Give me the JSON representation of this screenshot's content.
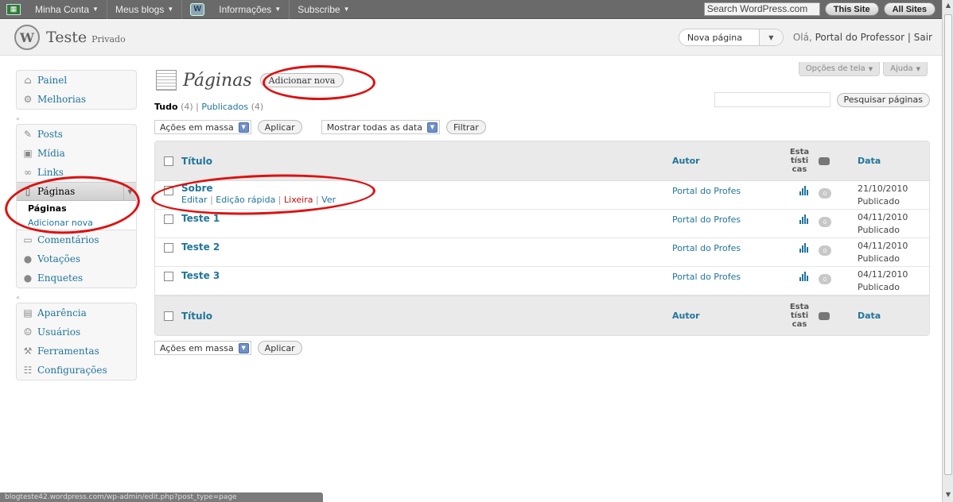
{
  "topbar": {
    "account": "Minha Conta",
    "blogs": "Meus blogs",
    "info": "Informações",
    "subscribe": "Subscribe",
    "search": "Search WordPress.com",
    "this_site": "This Site",
    "all_sites": "All Sites"
  },
  "header": {
    "logo_letter": "W",
    "site_title": "Teste",
    "site_private": "Privado",
    "new_page": "Nova página",
    "greeting": "Olá, ",
    "user": "Portal do Professor",
    "separator": " | ",
    "logout": "Sair"
  },
  "screen_options": {
    "options": "Opções de tela",
    "help": "Ajuda"
  },
  "sidebar": {
    "painel": "Painel",
    "melhorias": "Melhorias",
    "posts": "Posts",
    "midia": "Mídia",
    "links": "Links",
    "paginas": "Páginas",
    "sub_paginas": "Páginas",
    "sub_add": "Adicionar nova",
    "comentarios": "Comentários",
    "votacoes": "Votações",
    "enquetes": "Enquetes",
    "aparencia": "Aparência",
    "usuarios": "Usuários",
    "ferramentas": "Ferramentas",
    "configuracoes": "Configurações"
  },
  "main": {
    "title": "Páginas",
    "add_new": "Adicionar nova",
    "filter_all": "Tudo",
    "filter_all_count": "(4)",
    "filter_sep": "|",
    "filter_published": "Publicados",
    "filter_published_count": "(4)",
    "search_button": "Pesquisar páginas",
    "bulk_actions": "Ações em massa",
    "apply": "Aplicar",
    "dates": "Mostrar todas as data",
    "filter": "Filtrar"
  },
  "table": {
    "col_title": "Título",
    "col_author": "Autor",
    "col_stats": "Esta\ntísti\ncas",
    "col_date": "Data",
    "rows": [
      {
        "title": "Sobre",
        "author": "Portal do Profes",
        "comments": "0",
        "date": "21/10/2010",
        "status": "Publicado"
      },
      {
        "title": "Teste 1",
        "author": "Portal do Profes",
        "comments": "0",
        "date": "04/11/2010",
        "status": "Publicado"
      },
      {
        "title": "Teste 2",
        "author": "Portal do Profes",
        "comments": "0",
        "date": "04/11/2010",
        "status": "Publicado"
      },
      {
        "title": "Teste 3",
        "author": "Portal do Profes",
        "comments": "0",
        "date": "04/11/2010",
        "status": "Publicado"
      }
    ],
    "row_actions": {
      "edit": "Editar",
      "quick": "Edição rápida",
      "trash": "Lixeira",
      "view": "Ver"
    }
  },
  "status_bar": "blogteste42.wordpress.com/wp-admin/edit.php?post_type=page",
  "colors": {
    "link": "#21759b",
    "annotation": "#dd1111",
    "trash": "#bc0b0b"
  }
}
